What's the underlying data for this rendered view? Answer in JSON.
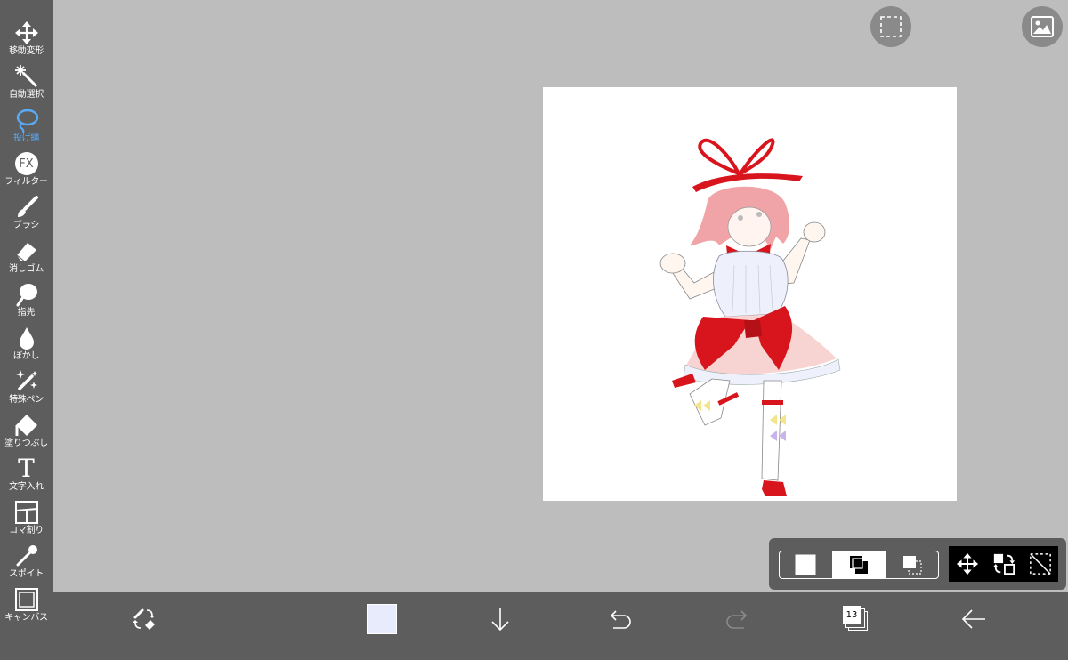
{
  "toolbar": {
    "tools": [
      {
        "label": "移動変形",
        "icon": "move-arrows-icon"
      },
      {
        "label": "自動選択",
        "icon": "magic-wand-icon"
      },
      {
        "label": "投げ縄",
        "icon": "lasso-icon",
        "active": true
      },
      {
        "label": "フィルター",
        "icon": "fx-filter-icon"
      },
      {
        "label": "ブラシ",
        "icon": "brush-icon"
      },
      {
        "label": "消しゴム",
        "icon": "eraser-icon"
      },
      {
        "label": "指先",
        "icon": "smudge-finger-icon"
      },
      {
        "label": "ぼかし",
        "icon": "blur-drop-icon"
      },
      {
        "label": "特殊ペン",
        "icon": "special-pen-icon"
      },
      {
        "label": "塗りつぶし",
        "icon": "fill-bucket-icon"
      },
      {
        "label": "文字入れ",
        "icon": "text-t-icon"
      },
      {
        "label": "コマ割り",
        "icon": "panel-divide-icon"
      },
      {
        "label": "スポイト",
        "icon": "eyedropper-icon"
      },
      {
        "label": "キャンバス",
        "icon": "canvas-frame-icon"
      }
    ],
    "fx_glyph": "FX",
    "text_glyph": "T",
    "active_color": "#5aaaf5"
  },
  "top_buttons": {
    "selection_icon": "dashed-selection-icon",
    "gallery_icon": "image-gallery-icon"
  },
  "bottom_bar": {
    "brush_swap_icon": "brush-eraser-swap-icon",
    "current_color": "#e8ebfb",
    "download_icon": "arrow-down-icon",
    "undo_icon": "undo-icon",
    "redo_icon": "redo-icon",
    "layer_count": "13",
    "back_icon": "arrow-left-icon"
  },
  "selection_panel": {
    "modes": [
      "new-selection-icon",
      "add-selection-icon",
      "subtract-selection-icon"
    ],
    "active_mode_index": 1,
    "actions": [
      "move-selection-icon",
      "invert-selection-icon",
      "clear-selection-icon"
    ]
  },
  "canvas": {
    "background": "#ffffff"
  }
}
